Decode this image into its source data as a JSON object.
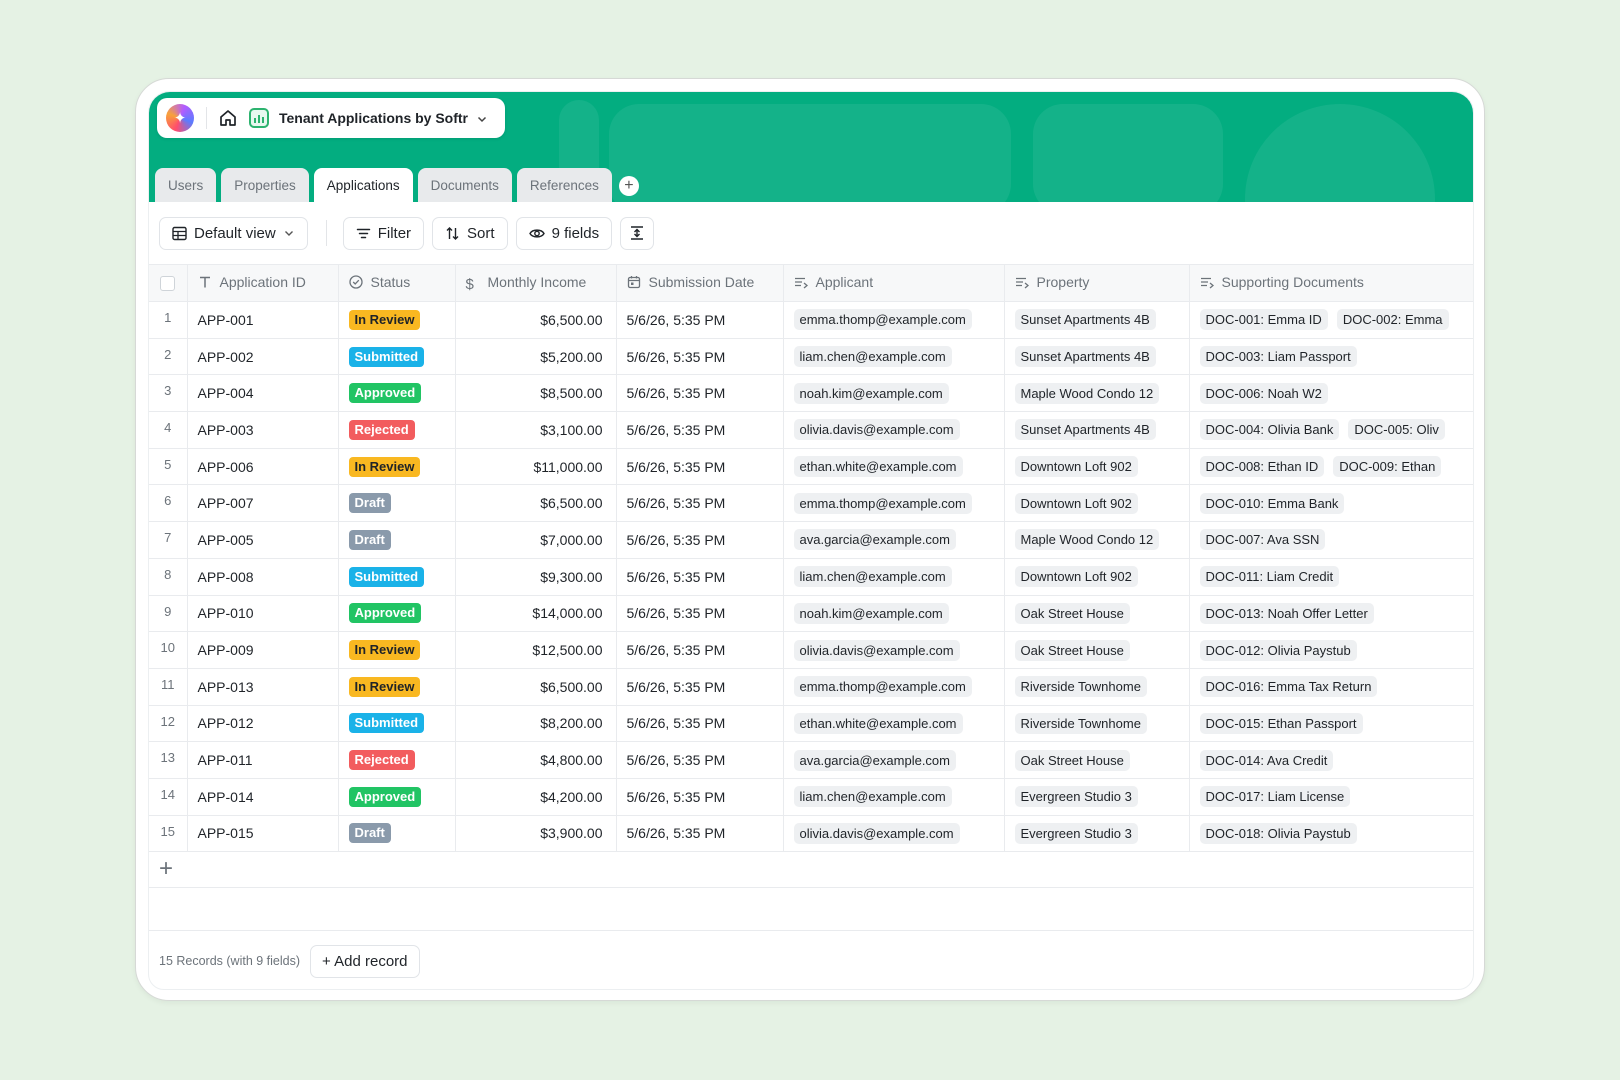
{
  "app": {
    "title": "Tenant Applications by Softr"
  },
  "tabs": [
    {
      "label": "Users",
      "active": false
    },
    {
      "label": "Properties",
      "active": false
    },
    {
      "label": "Applications",
      "active": true
    },
    {
      "label": "Documents",
      "active": false
    },
    {
      "label": "References",
      "active": false
    }
  ],
  "toolbar": {
    "view_label": "Default view",
    "filter_label": "Filter",
    "sort_label": "Sort",
    "fields_label": "9 fields"
  },
  "columns": [
    "Application ID",
    "Status",
    "Monthly Income",
    "Submission Date",
    "Applicant",
    "Property",
    "Supporting Documents"
  ],
  "status_colors": {
    "In Review": "#f9b821",
    "Submitted": "#1ab2e8",
    "Approved": "#21c464",
    "Rejected": "#f25c5e",
    "Draft": "#8a9aab"
  },
  "rows": [
    {
      "n": "1",
      "id": "APP-001",
      "status": "In Review",
      "income": "$6,500.00",
      "date": "5/6/26, 5:35 PM",
      "applicant": "emma.thomp@example.com",
      "property": "Sunset Apartments 4B",
      "docs": [
        "DOC-001: Emma ID",
        "DOC-002: Emma"
      ]
    },
    {
      "n": "2",
      "id": "APP-002",
      "status": "Submitted",
      "income": "$5,200.00",
      "date": "5/6/26, 5:35 PM",
      "applicant": "liam.chen@example.com",
      "property": "Sunset Apartments 4B",
      "docs": [
        "DOC-003: Liam Passport"
      ]
    },
    {
      "n": "3",
      "id": "APP-004",
      "status": "Approved",
      "income": "$8,500.00",
      "date": "5/6/26, 5:35 PM",
      "applicant": "noah.kim@example.com",
      "property": "Maple Wood Condo 12",
      "docs": [
        "DOC-006: Noah W2"
      ]
    },
    {
      "n": "4",
      "id": "APP-003",
      "status": "Rejected",
      "income": "$3,100.00",
      "date": "5/6/26, 5:35 PM",
      "applicant": "olivia.davis@example.com",
      "property": "Sunset Apartments 4B",
      "docs": [
        "DOC-004: Olivia Bank",
        "DOC-005: Oliv"
      ]
    },
    {
      "n": "5",
      "id": "APP-006",
      "status": "In Review",
      "income": "$11,000.00",
      "date": "5/6/26, 5:35 PM",
      "applicant": "ethan.white@example.com",
      "property": "Downtown Loft 902",
      "docs": [
        "DOC-008: Ethan ID",
        "DOC-009: Ethan"
      ]
    },
    {
      "n": "6",
      "id": "APP-007",
      "status": "Draft",
      "income": "$6,500.00",
      "date": "5/6/26, 5:35 PM",
      "applicant": "emma.thomp@example.com",
      "property": "Downtown Loft 902",
      "docs": [
        "DOC-010: Emma Bank"
      ]
    },
    {
      "n": "7",
      "id": "APP-005",
      "status": "Draft",
      "income": "$7,000.00",
      "date": "5/6/26, 5:35 PM",
      "applicant": "ava.garcia@example.com",
      "property": "Maple Wood Condo 12",
      "docs": [
        "DOC-007: Ava SSN"
      ]
    },
    {
      "n": "8",
      "id": "APP-008",
      "status": "Submitted",
      "income": "$9,300.00",
      "date": "5/6/26, 5:35 PM",
      "applicant": "liam.chen@example.com",
      "property": "Downtown Loft 902",
      "docs": [
        "DOC-011: Liam Credit"
      ]
    },
    {
      "n": "9",
      "id": "APP-010",
      "status": "Approved",
      "income": "$14,000.00",
      "date": "5/6/26, 5:35 PM",
      "applicant": "noah.kim@example.com",
      "property": "Oak Street House",
      "docs": [
        "DOC-013: Noah Offer Letter"
      ]
    },
    {
      "n": "10",
      "id": "APP-009",
      "status": "In Review",
      "income": "$12,500.00",
      "date": "5/6/26, 5:35 PM",
      "applicant": "olivia.davis@example.com",
      "property": "Oak Street House",
      "docs": [
        "DOC-012: Olivia Paystub"
      ]
    },
    {
      "n": "11",
      "id": "APP-013",
      "status": "In Review",
      "income": "$6,500.00",
      "date": "5/6/26, 5:35 PM",
      "applicant": "emma.thomp@example.com",
      "property": "Riverside Townhome",
      "docs": [
        "DOC-016: Emma Tax Return"
      ]
    },
    {
      "n": "12",
      "id": "APP-012",
      "status": "Submitted",
      "income": "$8,200.00",
      "date": "5/6/26, 5:35 PM",
      "applicant": "ethan.white@example.com",
      "property": "Riverside Townhome",
      "docs": [
        "DOC-015: Ethan Passport"
      ]
    },
    {
      "n": "13",
      "id": "APP-011",
      "status": "Rejected",
      "income": "$4,800.00",
      "date": "5/6/26, 5:35 PM",
      "applicant": "ava.garcia@example.com",
      "property": "Oak Street House",
      "docs": [
        "DOC-014: Ava Credit"
      ]
    },
    {
      "n": "14",
      "id": "APP-014",
      "status": "Approved",
      "income": "$4,200.00",
      "date": "5/6/26, 5:35 PM",
      "applicant": "liam.chen@example.com",
      "property": "Evergreen Studio 3",
      "docs": [
        "DOC-017: Liam License"
      ]
    },
    {
      "n": "15",
      "id": "APP-015",
      "status": "Draft",
      "income": "$3,900.00",
      "date": "5/6/26, 5:35 PM",
      "applicant": "olivia.davis@example.com",
      "property": "Evergreen Studio 3",
      "docs": [
        "DOC-018: Olivia Paystub"
      ]
    }
  ],
  "footer": {
    "record_count": "15 Records (with 9 fields)",
    "add_record_label": "+ Add record"
  }
}
